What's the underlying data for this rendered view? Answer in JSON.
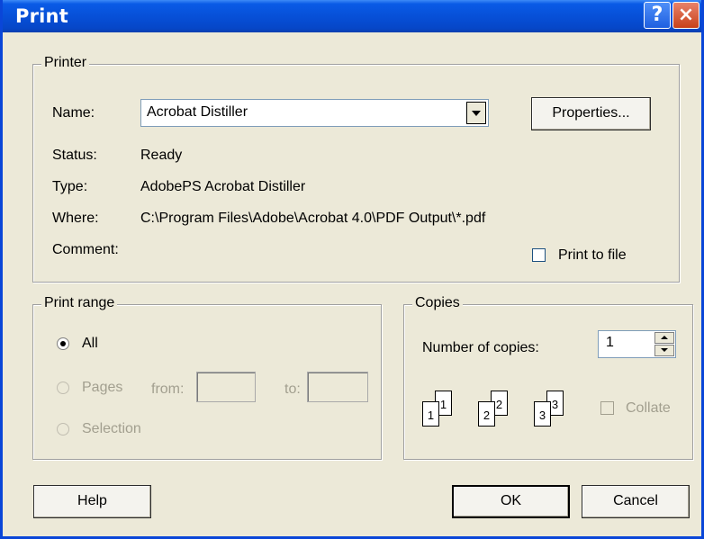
{
  "window": {
    "title": "Print",
    "help_glyph": "?",
    "close_glyph": "×"
  },
  "printer": {
    "legend": "Printer",
    "name_label": "Name:",
    "name_value": "Acrobat Distiller",
    "properties_label": "Properties...",
    "status_label": "Status:",
    "status_value": "Ready",
    "type_label": "Type:",
    "type_value": "AdobePS Acrobat Distiller",
    "where_label": "Where:",
    "where_value": "C:\\Program Files\\Adobe\\Acrobat 4.0\\PDF Output\\*.pdf",
    "comment_label": "Comment:",
    "print_to_file_label": "Print to file",
    "print_to_file_checked": false
  },
  "print_range": {
    "legend": "Print range",
    "all_label": "All",
    "pages_label": "Pages",
    "from_label": "from:",
    "to_label": "to:",
    "from_value": "",
    "to_value": "",
    "selection_label": "Selection",
    "selected": "All"
  },
  "copies": {
    "legend": "Copies",
    "number_label": "Number of copies:",
    "number_value": "1",
    "collate_label": "Collate",
    "collate_checked": false,
    "page_numbers": [
      "1",
      "1",
      "2",
      "2",
      "3",
      "3"
    ]
  },
  "buttons": {
    "help": "Help",
    "ok": "OK",
    "cancel": "Cancel"
  },
  "colors": {
    "titlebar": "#0750d8",
    "dialog_bg": "#ece9d8",
    "disabled_text": "#a29f8f"
  }
}
